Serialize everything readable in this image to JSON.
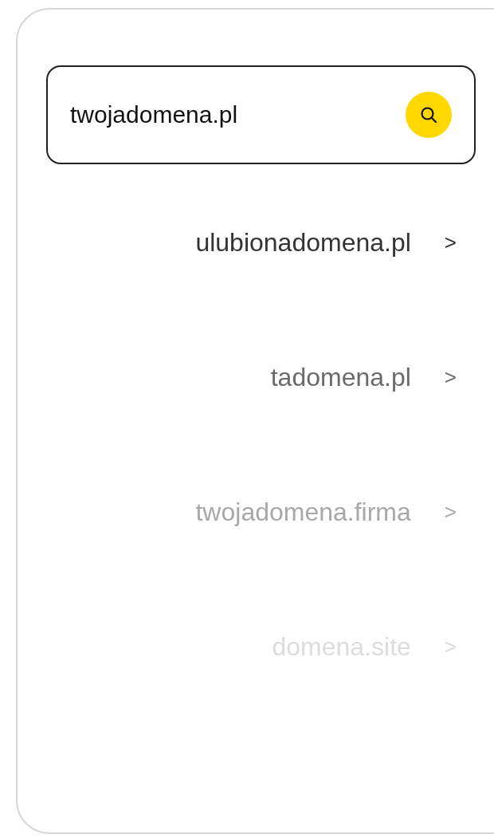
{
  "search": {
    "value": "twojadomena.pl"
  },
  "suggestions": [
    {
      "label": "ulubionadomena.pl",
      "arrow": ">",
      "color": "#333333"
    },
    {
      "label": "tadomena.pl",
      "arrow": ">",
      "color": "#6a6a6a"
    },
    {
      "label": "twojadomena.firma",
      "arrow": ">",
      "color": "#a8a8a8"
    },
    {
      "label": "domena.site",
      "arrow": ">",
      "color": "#dcdcdc"
    }
  ]
}
